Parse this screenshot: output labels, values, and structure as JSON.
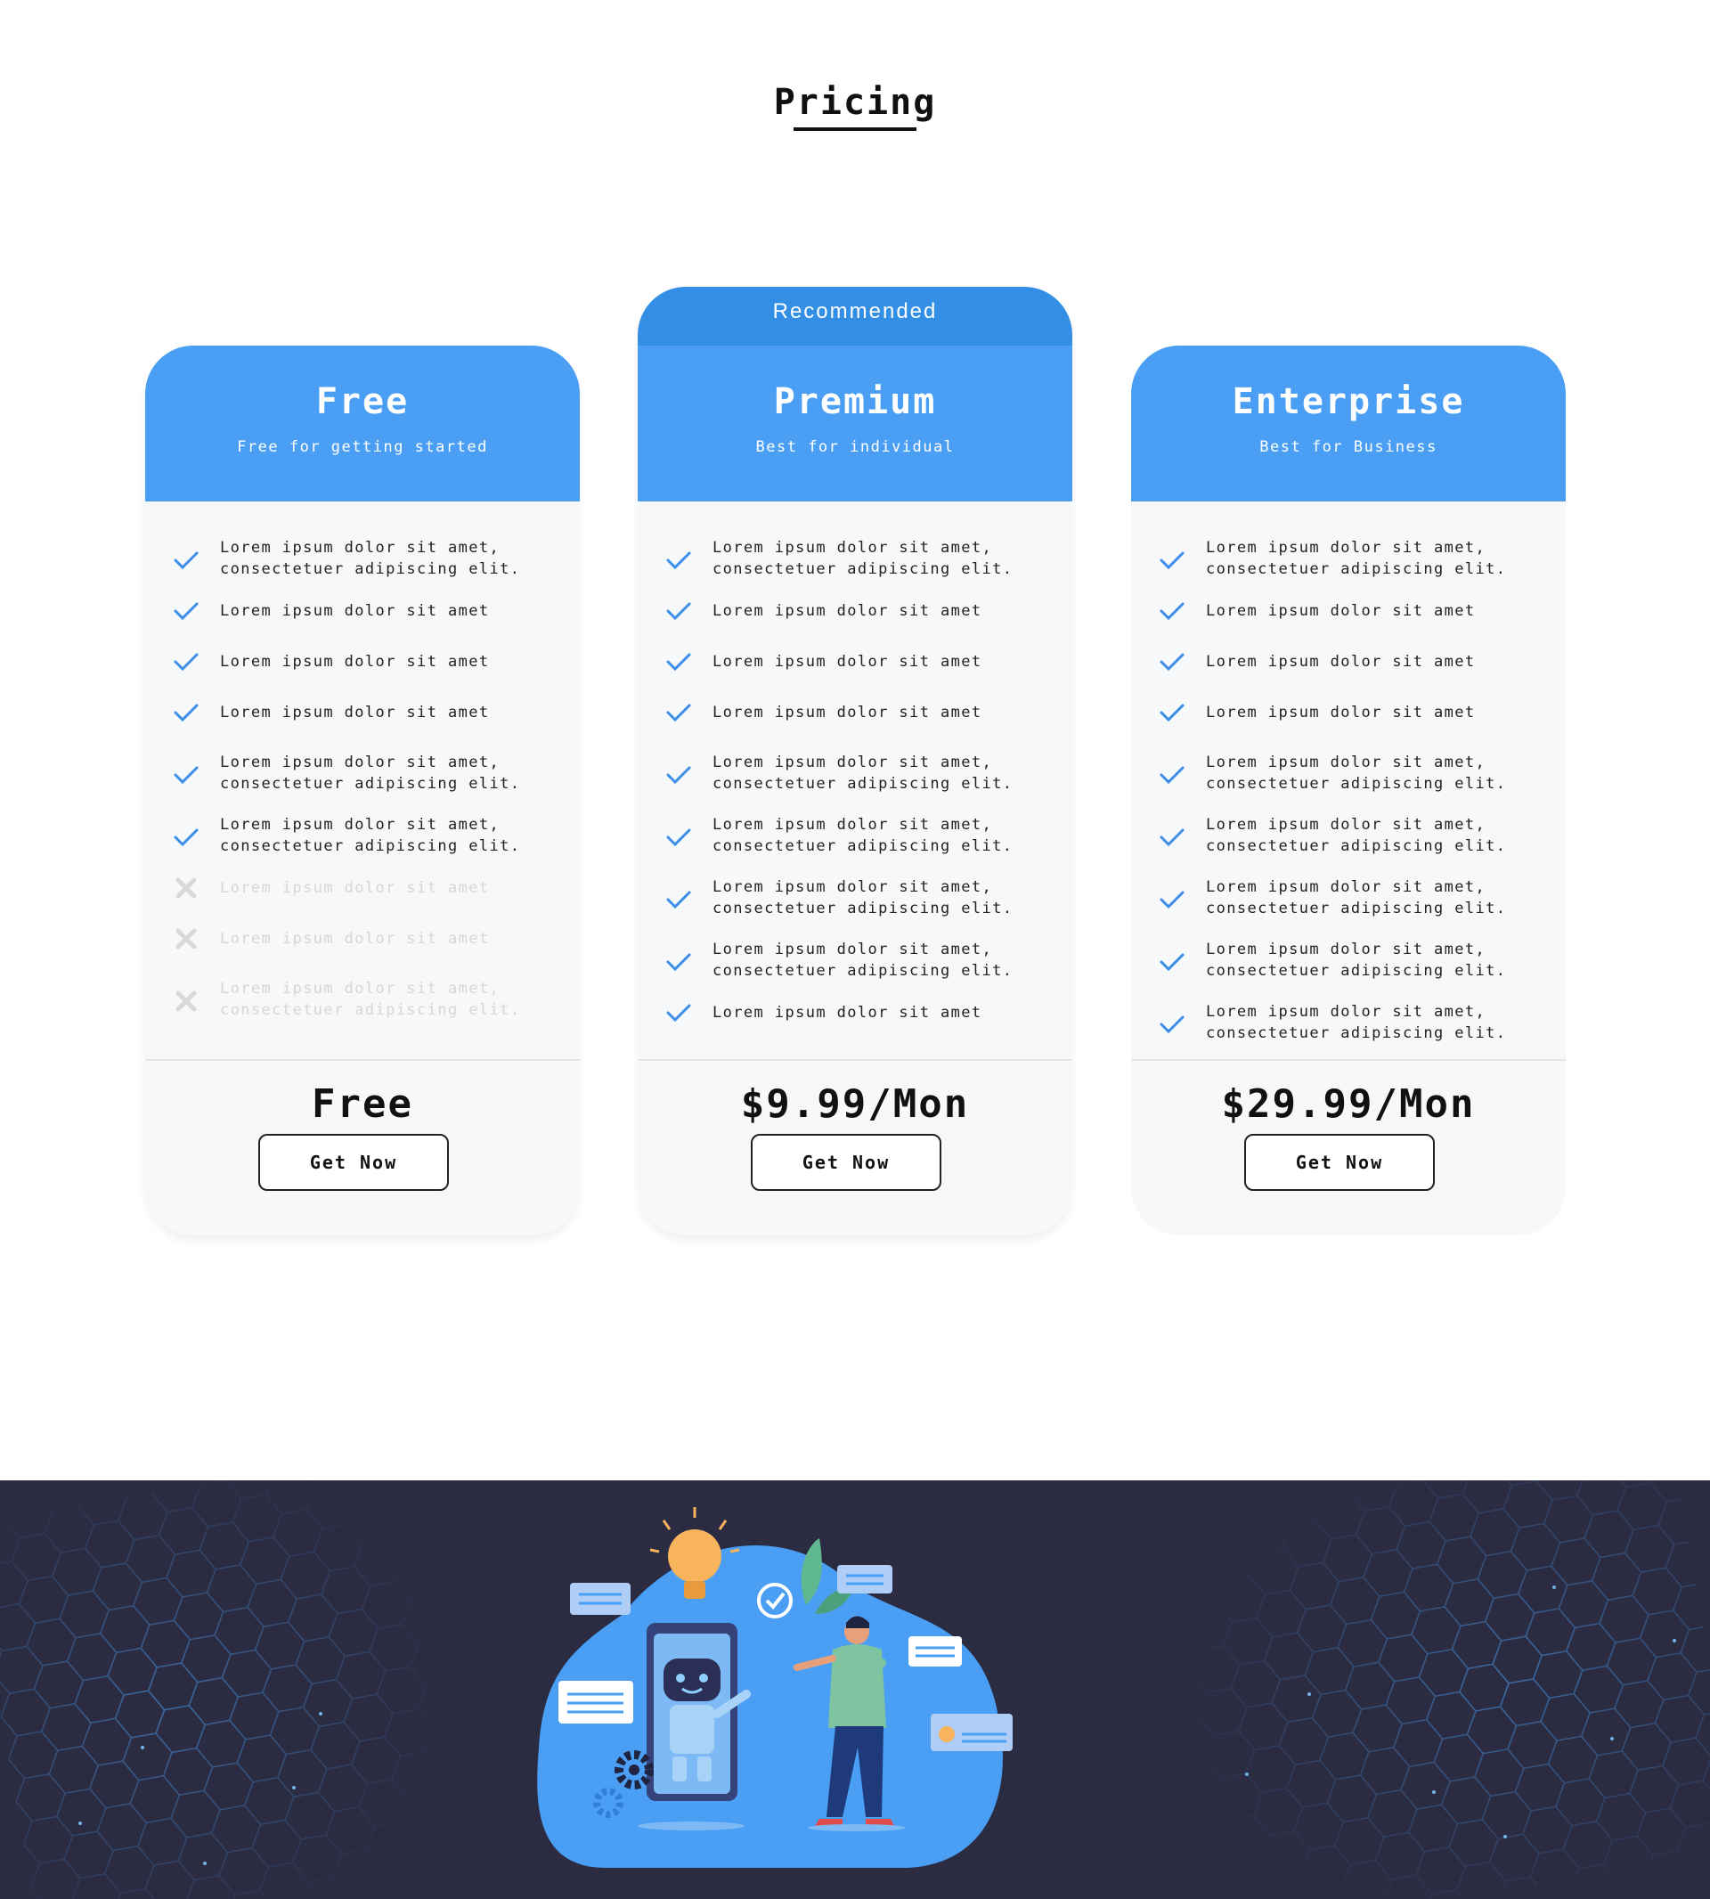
{
  "page": {
    "title": "Pricing"
  },
  "plans": [
    {
      "name": "Free",
      "subtitle": "Free for getting started",
      "price": "Free",
      "button": "Get Now",
      "features": [
        {
          "text": "Lorem ipsum dolor sit amet,\nconsectetuer adipiscing elit.",
          "included": true
        },
        {
          "text": "Lorem ipsum dolor sit amet",
          "included": true
        },
        {
          "text": "Lorem ipsum dolor sit amet",
          "included": true
        },
        {
          "text": "Lorem ipsum dolor sit amet",
          "included": true
        },
        {
          "text": "Lorem ipsum dolor sit amet,\nconsectetuer adipiscing elit.",
          "included": true
        },
        {
          "text": "Lorem ipsum dolor sit amet,\nconsectetuer adipiscing elit.",
          "included": true
        },
        {
          "text": "Lorem ipsum dolor sit amet",
          "included": false
        },
        {
          "text": "Lorem ipsum dolor sit amet",
          "included": false
        },
        {
          "text": "Lorem ipsum dolor sit amet,\nconsectetuer adipiscing elit.",
          "included": false
        }
      ]
    },
    {
      "name": "Premium",
      "subtitle": "Best for individual",
      "badge": "Recommended",
      "price": "$9.99/Mon",
      "button": "Get Now",
      "features": [
        {
          "text": "Lorem ipsum dolor sit amet,\nconsectetuer adipiscing elit.",
          "included": true
        },
        {
          "text": "Lorem ipsum dolor sit amet",
          "included": true
        },
        {
          "text": "Lorem ipsum dolor sit amet",
          "included": true
        },
        {
          "text": "Lorem ipsum dolor sit amet",
          "included": true
        },
        {
          "text": "Lorem ipsum dolor sit amet,\nconsectetuer adipiscing elit.",
          "included": true
        },
        {
          "text": "Lorem ipsum dolor sit amet,\nconsectetuer adipiscing elit.",
          "included": true
        },
        {
          "text": "Lorem ipsum dolor sit amet,\nconsectetuer adipiscing elit.",
          "included": true
        },
        {
          "text": "Lorem ipsum dolor sit amet,\nconsectetuer adipiscing elit.",
          "included": true
        },
        {
          "text": "Lorem ipsum dolor sit amet",
          "included": true
        }
      ]
    },
    {
      "name": "Enterprise",
      "subtitle": "Best for Business",
      "price": "$29.99/Mon",
      "button": "Get Now",
      "features": [
        {
          "text": "Lorem ipsum dolor sit amet,\nconsectetuer adipiscing elit.",
          "included": true
        },
        {
          "text": "Lorem ipsum dolor sit amet",
          "included": true
        },
        {
          "text": "Lorem ipsum dolor sit amet",
          "included": true
        },
        {
          "text": "Lorem ipsum dolor sit amet",
          "included": true
        },
        {
          "text": "Lorem ipsum dolor sit amet,\nconsectetuer adipiscing elit.",
          "included": true
        },
        {
          "text": "Lorem ipsum dolor sit amet,\nconsectetuer adipiscing elit.",
          "included": true
        },
        {
          "text": "Lorem ipsum dolor sit amet,\nconsectetuer adipiscing elit.",
          "included": true
        },
        {
          "text": "Lorem ipsum dolor sit amet,\nconsectetuer adipiscing elit.",
          "included": true
        },
        {
          "text": "Lorem ipsum dolor sit amet,\nconsectetuer adipiscing elit.",
          "included": true
        }
      ]
    }
  ],
  "icons": {
    "included": "check-icon",
    "excluded": "x-icon"
  },
  "colors": {
    "accent": "#4a9ff5",
    "ribbon": "#338fe6",
    "check": "#3b8fe8",
    "excluded": "#d9d9d9",
    "card_bg": "#f7f8f9",
    "footer_bg": "#2b2b42"
  },
  "footer": {
    "illustration": "chatbot-support-illustration"
  }
}
